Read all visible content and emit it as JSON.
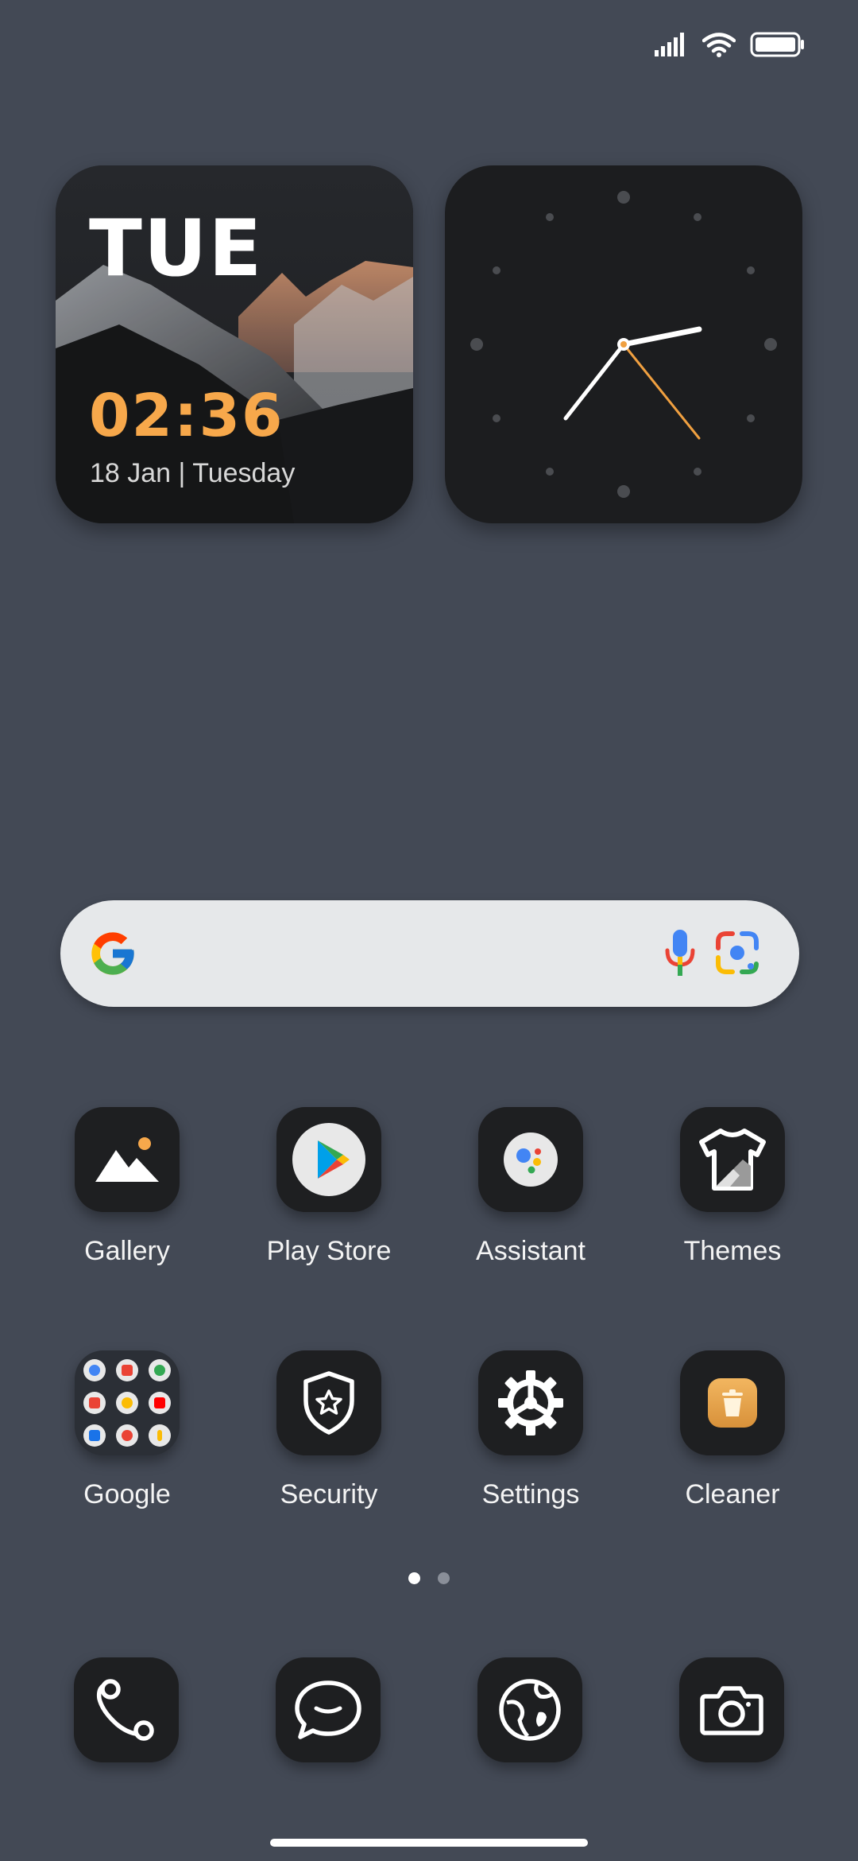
{
  "status_bar": {
    "icons": [
      "signal-icon",
      "wifi-icon",
      "battery-icon"
    ]
  },
  "date_widget": {
    "day": "TUE",
    "time": "02:36",
    "date_line": "18 Jan | Tuesday",
    "accent_color": "#f7a84b"
  },
  "clock_widget": {
    "hour": 2,
    "minute": 36,
    "second_hand_color": "#f0a040"
  },
  "search_bar": {
    "icons": [
      "google-g-icon",
      "microphone-icon",
      "google-lens-icon"
    ]
  },
  "apps": [
    {
      "label": "Gallery",
      "icon": "gallery-icon"
    },
    {
      "label": "Play Store",
      "icon": "play-store-icon"
    },
    {
      "label": "Assistant",
      "icon": "assistant-icon"
    },
    {
      "label": "Themes",
      "icon": "themes-icon"
    },
    {
      "label": "Google",
      "icon": "google-folder-icon"
    },
    {
      "label": "Security",
      "icon": "security-icon"
    },
    {
      "label": "Settings",
      "icon": "settings-icon"
    },
    {
      "label": "Cleaner",
      "icon": "cleaner-icon"
    }
  ],
  "page_indicator": {
    "pages": 2,
    "current": 1
  },
  "dock": [
    {
      "icon": "phone-icon"
    },
    {
      "icon": "messages-icon"
    },
    {
      "icon": "browser-icon"
    },
    {
      "icon": "camera-icon"
    }
  ]
}
